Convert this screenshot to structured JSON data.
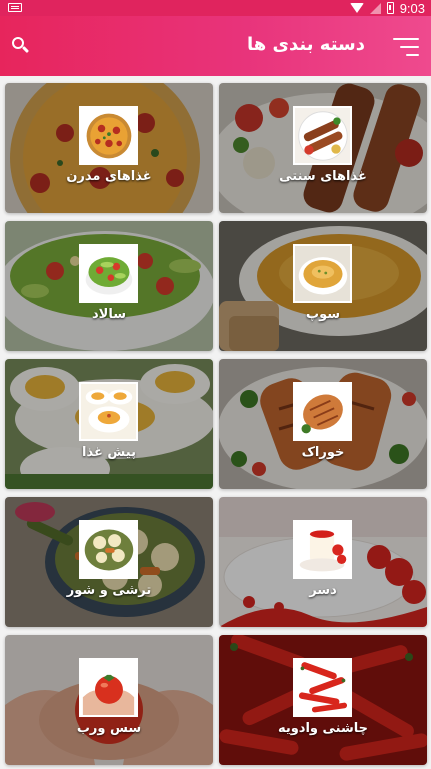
{
  "status_bar": {
    "time": "9:03"
  },
  "app_bar": {
    "title": "دسته بندی ها"
  },
  "categories": [
    {
      "label": "غذاهای سنتی",
      "icon": "kebab-plate-icon"
    },
    {
      "label": "غذاهای مدرن",
      "icon": "pizza-icon"
    },
    {
      "label": "سوپ",
      "icon": "soup-bowl-icon"
    },
    {
      "label": "سالاد",
      "icon": "salad-bowl-icon"
    },
    {
      "label": "خوراک",
      "icon": "grilled-chicken-icon"
    },
    {
      "label": "پیش غذا",
      "icon": "deviled-eggs-icon"
    },
    {
      "label": "دسر",
      "icon": "panna-cotta-icon"
    },
    {
      "label": "ترشی و شور",
      "icon": "pickles-icon"
    },
    {
      "label": "چاشنی وادویه",
      "icon": "chili-peppers-icon"
    },
    {
      "label": "سس ورب",
      "icon": "tomato-hands-icon"
    }
  ],
  "colors": {
    "app_bar": "#e7255c",
    "app_bar_end": "#ef4a8e",
    "background": "#f2f2f2"
  }
}
